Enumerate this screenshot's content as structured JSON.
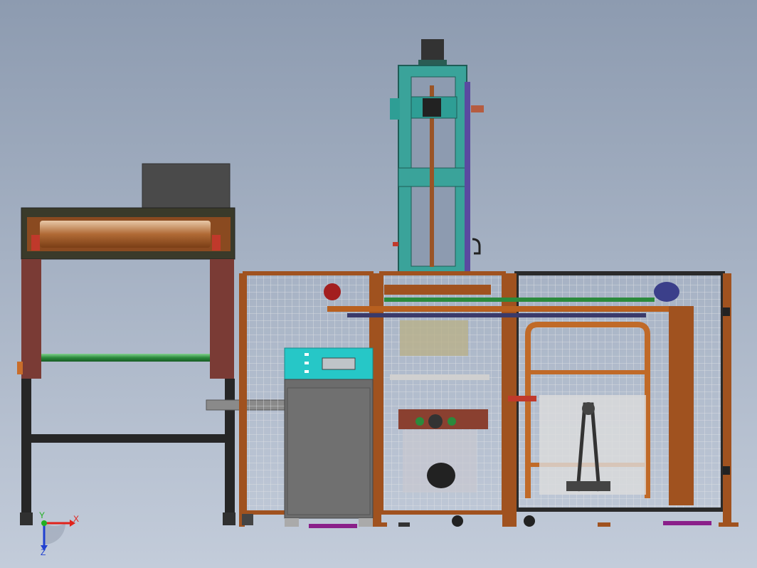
{
  "viewport": {
    "background_top": "#8d9bb0",
    "background_bottom": "#c3ccda"
  },
  "triad": {
    "x_label": "X",
    "y_label": "Y",
    "z_label": "Z",
    "x_color": "#e0221b",
    "y_color": "#22b022",
    "z_color": "#2040d0"
  },
  "palette": {
    "frame_orange": "#a0521f",
    "frame_dark": "#2a2a2a",
    "teal": "#3aa39a",
    "cyan_panel": "#26c7c7",
    "cabinet_gray": "#6c6c6c",
    "mesh": "#d4d8dc",
    "motor_navy": "#3b3f8a",
    "pad_purple": "#8a1f8a",
    "roller_green": "#2b8a3c"
  },
  "icons": {
    "triad": "coordinate-triad-icon",
    "motor": "servo-motor-icon"
  }
}
